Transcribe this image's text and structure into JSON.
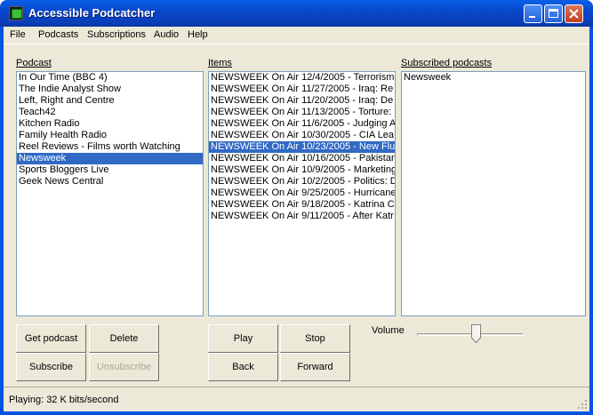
{
  "window": {
    "title": "Accessible Podcatcher"
  },
  "menu": [
    "File",
    "Podcasts",
    "Subscriptions",
    "Audio",
    "Help"
  ],
  "podcast_panel": {
    "label": "Podcast",
    "items": [
      "In Our Time (BBC 4)",
      "The Indie Analyst Show",
      "Left, Right and Centre",
      "Teach42",
      "Kitchen Radio",
      "Family Health Radio",
      "Reel Reviews - Films worth Watching",
      "Newsweek",
      "Sports Bloggers Live",
      "Geek News Central"
    ],
    "selected_index": 7
  },
  "items_panel": {
    "label": "Items",
    "items": [
      "NEWSWEEK On Air 12/4/2005 - Terrorism",
      "NEWSWEEK On Air 11/27/2005 - Iraq: Re",
      "NEWSWEEK On Air 11/20/2005 - Iraq: De",
      "NEWSWEEK On Air 11/13/2005 - Torture:",
      "NEWSWEEK On Air 11/6/2005 - Judging A",
      "NEWSWEEK On Air 10/30/2005 - CIA Lea",
      "NEWSWEEK On Air 10/23/2005 - New Flu",
      "NEWSWEEK On Air 10/16/2005 - Pakistan",
      "NEWSWEEK On Air 10/9/2005 - Marketing",
      "NEWSWEEK On Air 10/2/2005 - Politics: D",
      "NEWSWEEK On Air 9/25/2005 - Hurricane",
      "NEWSWEEK On Air 9/18/2005 - Katrina C",
      "NEWSWEEK On Air 9/11/2005 - After Katr"
    ],
    "selected_index": 6
  },
  "subscribed_panel": {
    "label": "Subscribed podcasts",
    "items": [
      "Newsweek"
    ]
  },
  "buttons": {
    "get_podcast": "Get podcast",
    "delete": "Delete",
    "subscribe": "Subscribe",
    "unsubscribe": "Unsubscribe",
    "play": "Play",
    "stop": "Stop",
    "back": "Back",
    "forward": "Forward"
  },
  "volume": {
    "label": "Volume",
    "level": 0.55
  },
  "status": {
    "text": "Playing: 32 K bits/second"
  },
  "colors": {
    "selection": "#316ac5",
    "titlebar": "#0a5fe8",
    "face": "#ece9d8"
  }
}
